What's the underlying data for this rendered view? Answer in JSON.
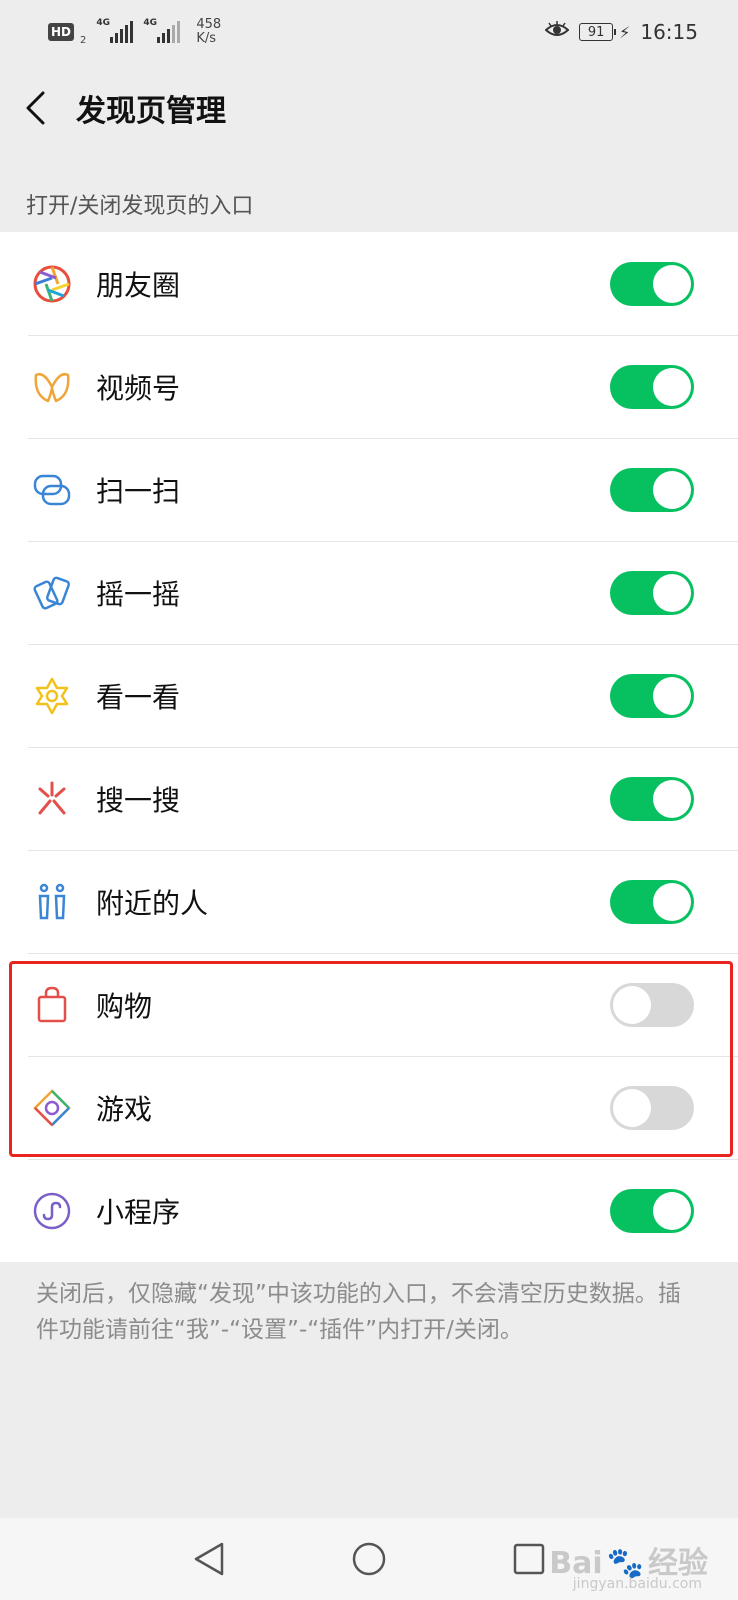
{
  "status_bar": {
    "hd_badge": "HD",
    "sim_num": "2",
    "sim1_label": "4G",
    "sim2_label": "4G",
    "net_speed_value": "458",
    "net_speed_unit": "K/s",
    "battery": "91",
    "time": "16:15"
  },
  "header": {
    "title": "发现页管理"
  },
  "section": {
    "label": "打开/关闭发现页的入口"
  },
  "items": [
    {
      "label": "朋友圈",
      "icon": "moments-icon",
      "enabled": true
    },
    {
      "label": "视频号",
      "icon": "channels-icon",
      "enabled": true
    },
    {
      "label": "扫一扫",
      "icon": "scan-icon",
      "enabled": true
    },
    {
      "label": "摇一摇",
      "icon": "shake-icon",
      "enabled": true
    },
    {
      "label": "看一看",
      "icon": "top-stories-icon",
      "enabled": true
    },
    {
      "label": "搜一搜",
      "icon": "search-icon",
      "enabled": true
    },
    {
      "label": "附近的人",
      "icon": "people-nearby-icon",
      "enabled": true
    },
    {
      "label": "购物",
      "icon": "shopping-bag-icon",
      "enabled": false
    },
    {
      "label": "游戏",
      "icon": "games-icon",
      "enabled": false
    },
    {
      "label": "小程序",
      "icon": "mini-programs-icon",
      "enabled": true
    }
  ],
  "footnote": "关闭后，仅隐藏“发现”中该功能的入口，不会清空历史数据。插件功能请前往“我”-“设置”-“插件”内打开/关闭。",
  "watermark": {
    "brand": "Bai",
    "suffix": "经验",
    "small": "jingyan.baidu.com"
  },
  "colors": {
    "toggle_on": "#07c160",
    "toggle_off": "#d8d8d8",
    "highlight": "#e8261f",
    "background": "#ededed"
  }
}
